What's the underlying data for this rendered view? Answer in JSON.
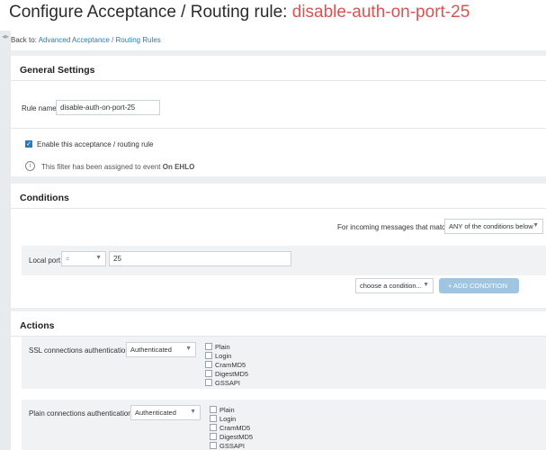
{
  "page": {
    "title_prefix": "Configure Acceptance / Routing rule: ",
    "title_rule": "disable-auth-on-port-25",
    "back_prefix": "Back to: ",
    "back_link": "Advanced Acceptance / Routing Rules"
  },
  "general": {
    "heading": "General Settings",
    "rule_name_label": "Rule name",
    "rule_name_value": "disable-auth-on-port-25",
    "enable_label": "Enable this acceptance / routing rule",
    "enable_checked": true,
    "event_text": "This filter has been assigned to event",
    "event_name": "On EHLO"
  },
  "conditions": {
    "heading": "Conditions",
    "match_label": "For incoming messages that match",
    "match_value": "ANY of the conditions below",
    "condition_label": "Local port",
    "operator": "=",
    "port_value": "25",
    "choose_placeholder": "choose a condition...",
    "add_button": "+ ADD CONDITION"
  },
  "actions": {
    "heading": "Actions",
    "ssl": {
      "label": "SSL connections authentication",
      "value": "Authenticated",
      "options": [
        "Plain",
        "Login",
        "CramMD5",
        "DigestMD5",
        "GSSAPI"
      ]
    },
    "plain": {
      "label": "Plain connections authentication",
      "value": "Authenticated",
      "options": [
        "Plain",
        "Login",
        "CramMD5",
        "DigestMD5",
        "GSSAPI"
      ]
    }
  }
}
